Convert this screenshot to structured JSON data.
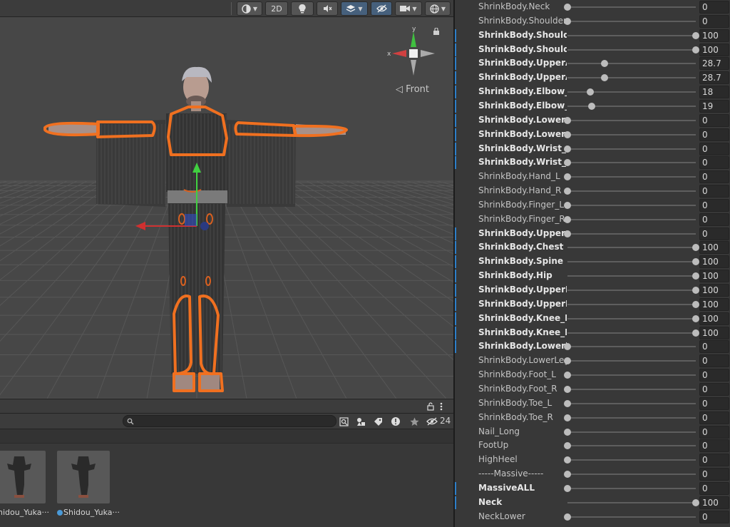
{
  "scene_view": {
    "toolbar": {
      "mode_2d_label": "2D"
    },
    "orientation_label": "◁ Front",
    "gizmo_axes": {
      "x": "x",
      "y": "y"
    }
  },
  "project": {
    "search": {
      "placeholder": "",
      "value": ""
    },
    "hidden_count": "24",
    "assets": [
      {
        "label": "Shidou_Yuka···"
      },
      {
        "label": "Shidou_Yuka···"
      }
    ]
  },
  "blend_shapes": [
    {
      "name": "ShrinkBody.Neck",
      "value": "0",
      "fraction": 0,
      "bold": false,
      "marked": false
    },
    {
      "name": "ShrinkBody.Shoulder",
      "value": "0",
      "fraction": 0,
      "bold": false,
      "marked": false
    },
    {
      "name": "ShrinkBody.Shoulder_L",
      "value": "100",
      "fraction": 1,
      "bold": true,
      "marked": true
    },
    {
      "name": "ShrinkBody.Shoulder_R",
      "value": "100",
      "fraction": 1,
      "bold": true,
      "marked": true
    },
    {
      "name": "ShrinkBody.UpperArm_",
      "value": "28.7",
      "fraction": 0.287,
      "bold": true,
      "marked": true
    },
    {
      "name": "ShrinkBody.UpperArm_",
      "value": "28.7",
      "fraction": 0.287,
      "bold": true,
      "marked": true
    },
    {
      "name": "ShrinkBody.Elbow_L",
      "value": "18",
      "fraction": 0.18,
      "bold": true,
      "marked": true
    },
    {
      "name": "ShrinkBody.Elbow_R",
      "value": "19",
      "fraction": 0.19,
      "bold": true,
      "marked": true
    },
    {
      "name": "ShrinkBody.LowerArm_",
      "value": "0",
      "fraction": 0,
      "bold": true,
      "marked": true
    },
    {
      "name": "ShrinkBody.LowerArm_",
      "value": "0",
      "fraction": 0,
      "bold": true,
      "marked": true
    },
    {
      "name": "ShrinkBody.Wrist_L",
      "value": "0",
      "fraction": 0,
      "bold": true,
      "marked": true
    },
    {
      "name": "ShrinkBody.Wrist_R",
      "value": "0",
      "fraction": 0,
      "bold": true,
      "marked": true
    },
    {
      "name": "ShrinkBody.Hand_L",
      "value": "0",
      "fraction": 0,
      "bold": false,
      "marked": false
    },
    {
      "name": "ShrinkBody.Hand_R",
      "value": "0",
      "fraction": 0,
      "bold": false,
      "marked": false
    },
    {
      "name": "ShrinkBody.Finger_L",
      "value": "0",
      "fraction": 0,
      "bold": false,
      "marked": false
    },
    {
      "name": "ShrinkBody.Finger_R",
      "value": "0",
      "fraction": 0,
      "bold": false,
      "marked": false
    },
    {
      "name": "ShrinkBody.UpperChest",
      "value": "0",
      "fraction": 0,
      "bold": true,
      "marked": true
    },
    {
      "name": "ShrinkBody.Chest",
      "value": "100",
      "fraction": 1,
      "bold": true,
      "marked": true
    },
    {
      "name": "ShrinkBody.Spine",
      "value": "100",
      "fraction": 1,
      "bold": true,
      "marked": true
    },
    {
      "name": "ShrinkBody.Hip",
      "value": "100",
      "fraction": 1,
      "bold": true,
      "marked": true
    },
    {
      "name": "ShrinkBody.UpperLeg_L",
      "value": "100",
      "fraction": 1,
      "bold": true,
      "marked": true
    },
    {
      "name": "ShrinkBody.UpperLeg_R",
      "value": "100",
      "fraction": 1,
      "bold": true,
      "marked": true
    },
    {
      "name": "ShrinkBody.Knee_L",
      "value": "100",
      "fraction": 1,
      "bold": true,
      "marked": true
    },
    {
      "name": "ShrinkBody.Knee_R",
      "value": "100",
      "fraction": 1,
      "bold": true,
      "marked": true
    },
    {
      "name": "ShrinkBody.LowerLeg_L",
      "value": "0",
      "fraction": 0,
      "bold": true,
      "marked": true
    },
    {
      "name": "ShrinkBody.LowerLeg_R",
      "value": "0",
      "fraction": 0,
      "bold": false,
      "marked": false
    },
    {
      "name": "ShrinkBody.Foot_L",
      "value": "0",
      "fraction": 0,
      "bold": false,
      "marked": false
    },
    {
      "name": "ShrinkBody.Foot_R",
      "value": "0",
      "fraction": 0,
      "bold": false,
      "marked": false
    },
    {
      "name": "ShrinkBody.Toe_L",
      "value": "0",
      "fraction": 0,
      "bold": false,
      "marked": false
    },
    {
      "name": "ShrinkBody.Toe_R",
      "value": "0",
      "fraction": 0,
      "bold": false,
      "marked": false
    },
    {
      "name": "Nail_Long",
      "value": "0",
      "fraction": 0,
      "bold": false,
      "marked": false
    },
    {
      "name": "FootUp",
      "value": "0",
      "fraction": 0,
      "bold": false,
      "marked": false
    },
    {
      "name": "HighHeel",
      "value": "0",
      "fraction": 0,
      "bold": false,
      "marked": false
    },
    {
      "name": "-----Massive-----",
      "value": "0",
      "fraction": 0,
      "bold": false,
      "marked": false
    },
    {
      "name": "MassiveALL",
      "value": "0",
      "fraction": 0,
      "bold": true,
      "marked": true
    },
    {
      "name": "Neck",
      "value": "100",
      "fraction": 1,
      "bold": true,
      "marked": true
    },
    {
      "name": "NeckLower",
      "value": "0",
      "fraction": 0,
      "bold": false,
      "marked": false
    }
  ],
  "colors": {
    "selection_outline": "#f07020",
    "axis_x": "#d03030",
    "axis_y": "#40d040",
    "axis_z": "#3050d0",
    "accent_blue": "#2d7ec8"
  }
}
